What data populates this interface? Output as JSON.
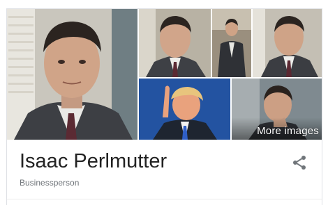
{
  "entity": {
    "name": "Isaac Perlmutter",
    "subtitle": "Businessperson"
  },
  "images": {
    "more_label": "More images",
    "tiles": [
      {
        "subject": "man-in-suit-closeup"
      },
      {
        "subject": "man-in-suit-portrait"
      },
      {
        "subject": "man-in-suit-seated"
      },
      {
        "subject": "man-in-suit-profile"
      },
      {
        "subject": "man-pointing-finger"
      },
      {
        "subject": "man-in-suit-lowlight"
      }
    ]
  },
  "icons": {
    "share": "share-icon"
  },
  "colors": {
    "title": "#222222",
    "subtitle": "#70757a",
    "icon": "#70757a",
    "border": "#dfe1e5"
  }
}
